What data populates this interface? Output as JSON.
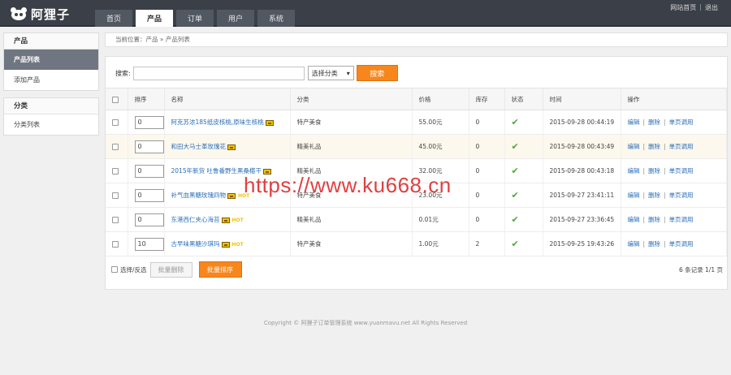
{
  "header": {
    "logo_text": "阿狸子",
    "nav": [
      {
        "label": "首页",
        "active": false
      },
      {
        "label": "产品",
        "active": true
      },
      {
        "label": "订单",
        "active": false
      },
      {
        "label": "用户",
        "active": false
      },
      {
        "label": "系统",
        "active": false
      }
    ],
    "links": {
      "site_home": "网站首页",
      "separator": "|",
      "logout": "退出"
    }
  },
  "sidebar": {
    "groups": [
      {
        "title": "产品",
        "items": [
          {
            "label": "产品列表",
            "active": true
          },
          {
            "label": "添加产品",
            "active": false
          }
        ]
      },
      {
        "title": "分类",
        "items": [
          {
            "label": "分类列表",
            "active": false
          }
        ]
      }
    ]
  },
  "breadcrumb": "当前位置：产品 » 产品列表",
  "search": {
    "label": "搜索:",
    "value": "",
    "category": "选择分类",
    "button": "搜索"
  },
  "table": {
    "columns": [
      "",
      "排序",
      "名称",
      "分类",
      "价格",
      "库存",
      "状态",
      "时间",
      "操作"
    ],
    "rows": [
      {
        "sort": "0",
        "name": "阿克苏浓185纸皮核桃,原味生核桃",
        "hot": "",
        "category": "特产美食",
        "price": "55.00元",
        "stock": "0",
        "time": "2015-09-28 00:44:19",
        "highlight": false
      },
      {
        "sort": "0",
        "name": "和田大马士革玫瑰花",
        "hot": "",
        "category": "精美礼品",
        "price": "45.00元",
        "stock": "0",
        "time": "2015-09-28 00:43:49",
        "highlight": true
      },
      {
        "sort": "0",
        "name": "2015年新货 吐鲁番野生黑桑椹干",
        "hot": "",
        "category": "精美礼品",
        "price": "32.00元",
        "stock": "0",
        "time": "2015-09-28 00:43:18",
        "highlight": false
      },
      {
        "sort": "0",
        "name": "补气血黑糖玫瑰四物",
        "hot": "HOT",
        "category": "特产美食",
        "price": "23.00元",
        "stock": "0",
        "time": "2015-09-27 23:41:11",
        "highlight": false
      },
      {
        "sort": "0",
        "name": "东港西仁夹心海苔",
        "hot": "HOT",
        "category": "精美礼品",
        "price": "0.01元",
        "stock": "0",
        "time": "2015-09-27 23:36:45",
        "highlight": false
      },
      {
        "sort": "10",
        "name": "古早味黑糖沙琪玛",
        "hot": "HOT",
        "category": "特产美食",
        "price": "1.00元",
        "stock": "2",
        "time": "2015-09-25 19:43:26",
        "highlight": false
      }
    ],
    "ops": {
      "edit": "编辑",
      "delete": "删除",
      "call": "单页调用",
      "sep": "|"
    },
    "status_icon": "checkmark-icon"
  },
  "footer": {
    "select_all": "选择/反选",
    "batch_delete": "批量删除",
    "batch_sort": "批量排序",
    "pager": "6 条记录 1/1 页"
  },
  "copyright": "Copyright ©  阿狸子订单管理系统 www.yuanmavu.net  All Rights Reserved",
  "watermark": "https://www.ku668.cn",
  "colors": {
    "accent": "#f7861c",
    "topbar": "#3b4048",
    "link": "#2a6eb8",
    "check": "#4fa832"
  }
}
